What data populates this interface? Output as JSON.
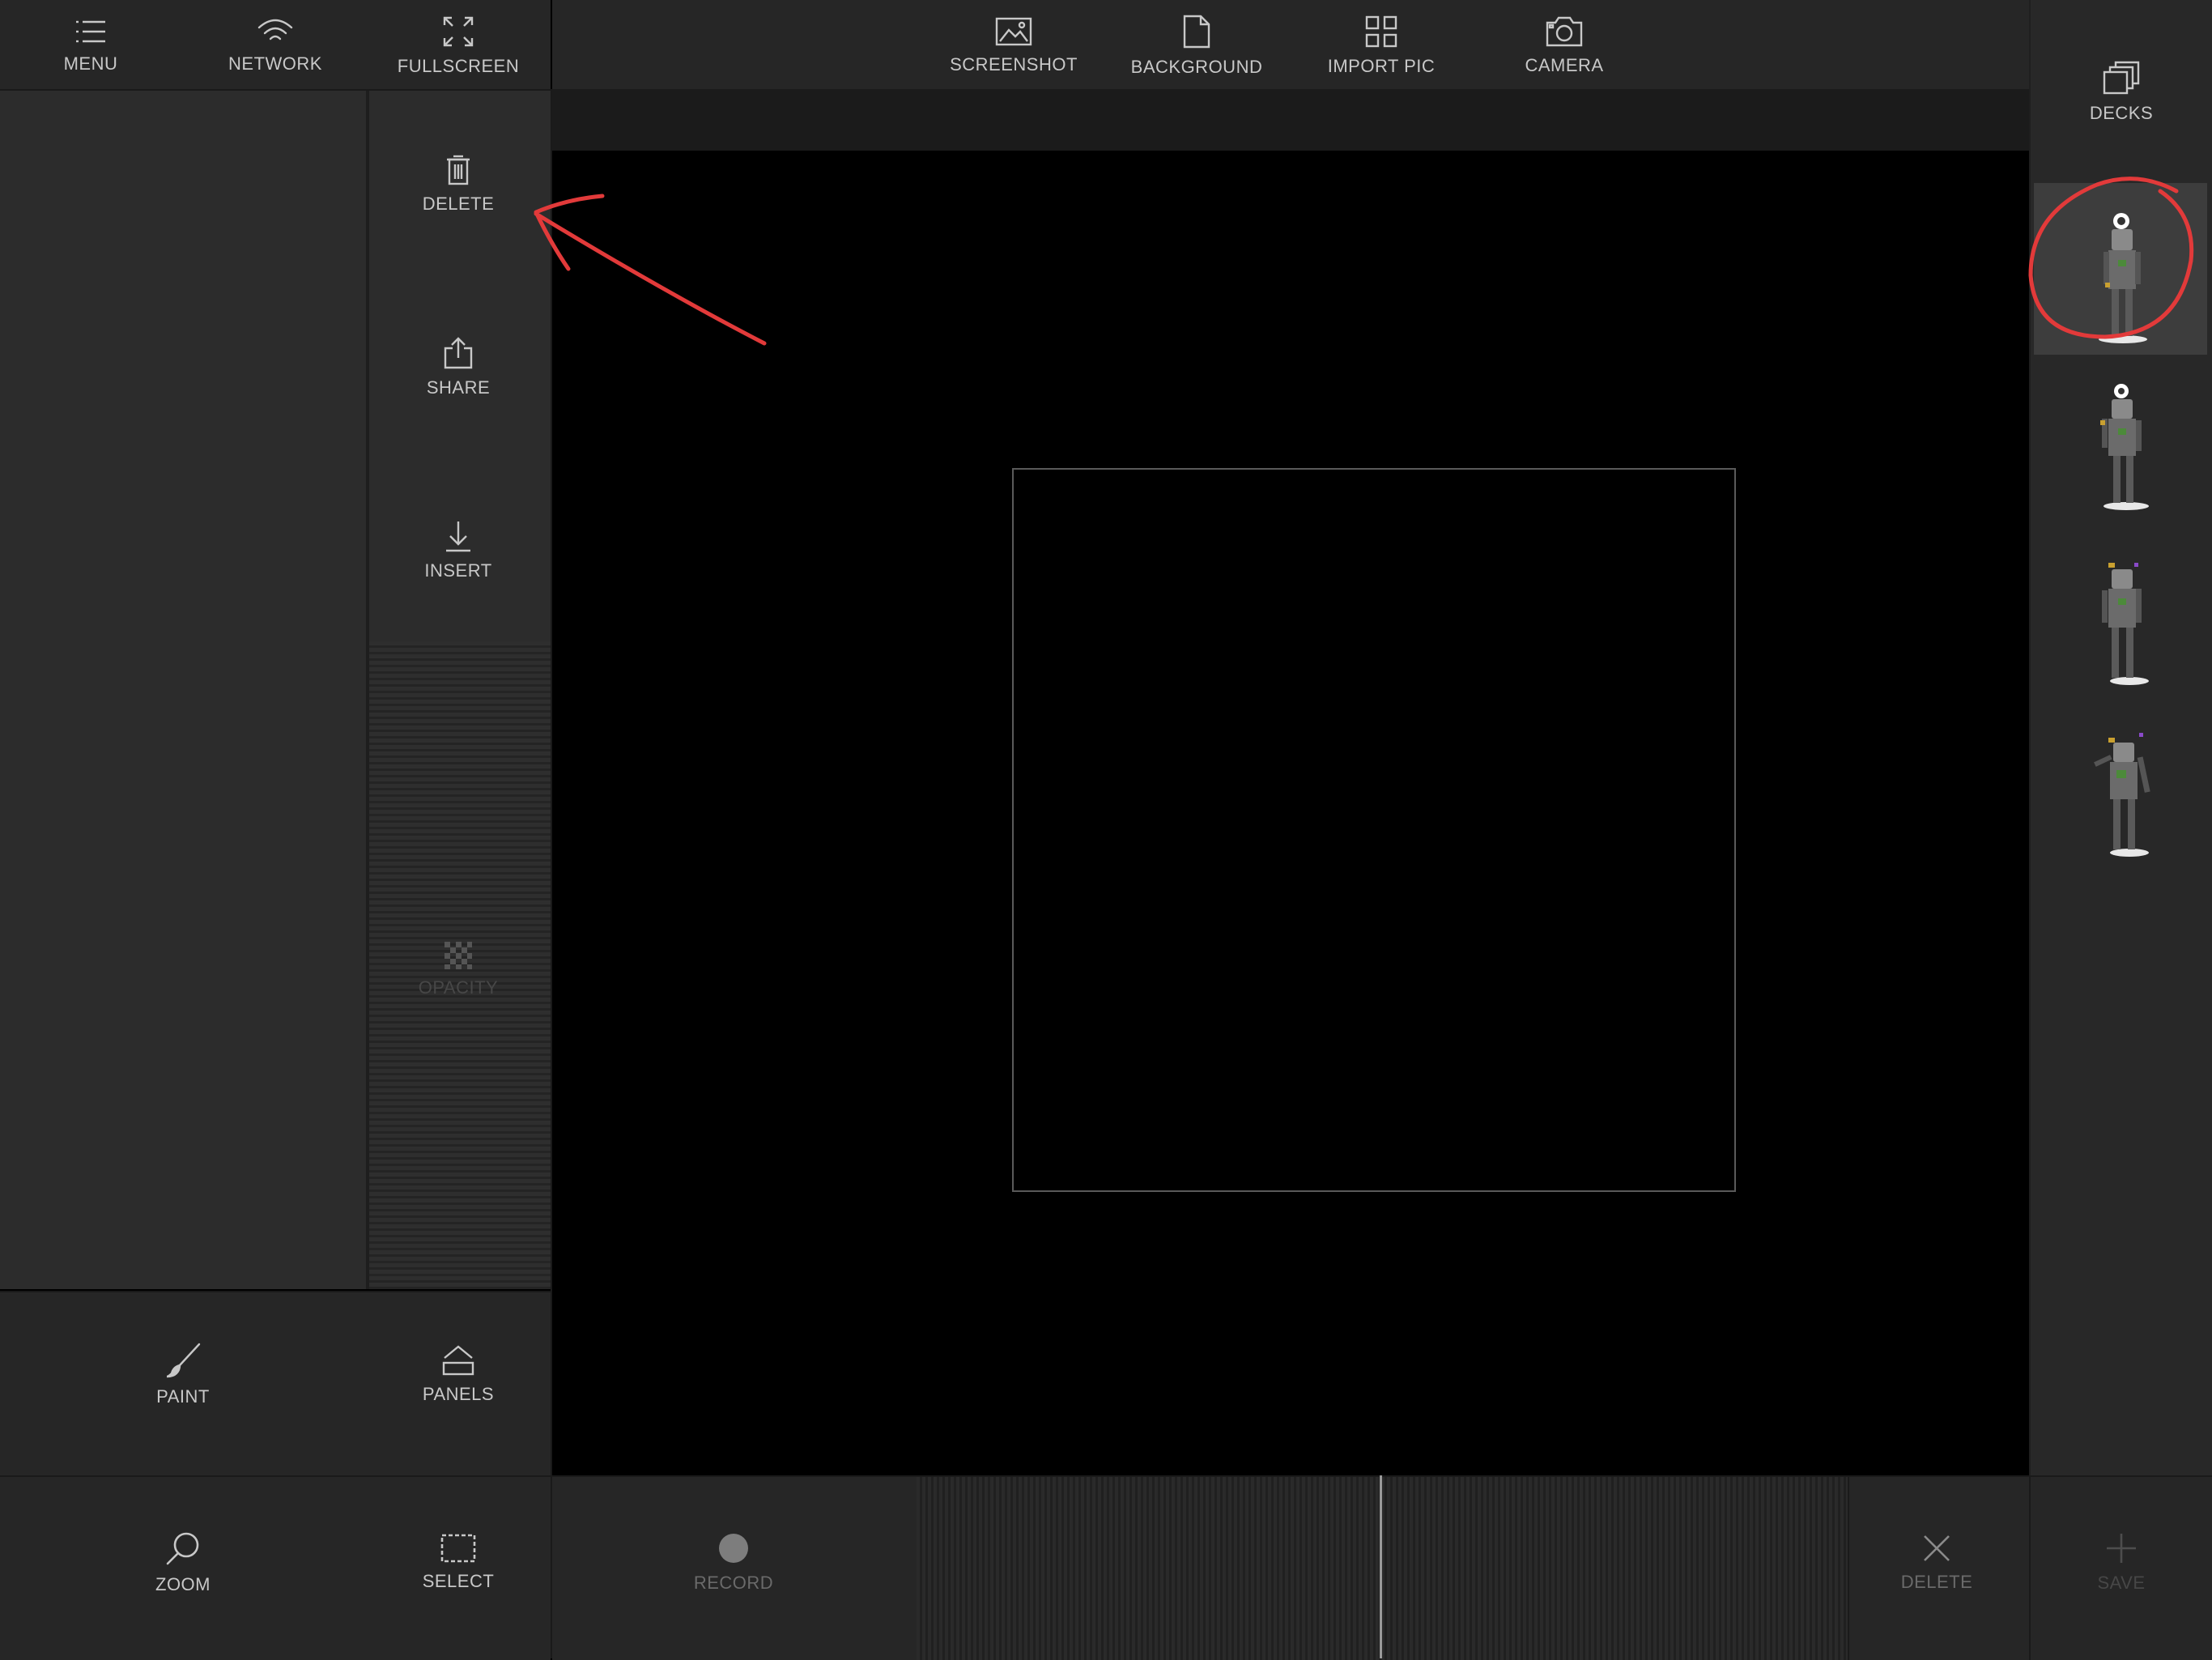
{
  "top_left_toolbar": {
    "menu": {
      "label": "MENU",
      "icon": "list-icon"
    },
    "network": {
      "label": "NETWORK",
      "icon": "wifi-icon"
    },
    "fullscreen": {
      "label": "FULLSCREEN",
      "icon": "expand-icon"
    }
  },
  "top_toolbar": {
    "screenshot": {
      "label": "SCREENSHOT",
      "icon": "image-icon"
    },
    "background": {
      "label": "BACKGROUND",
      "icon": "document-icon"
    },
    "import_pic": {
      "label": "IMPORT PIC",
      "icon": "grid-icon"
    },
    "camera": {
      "label": "CAMERA",
      "icon": "camera-icon"
    }
  },
  "right_panel": {
    "decks": {
      "label": "DECKS",
      "icon": "stack-icon"
    },
    "thumbnails": [
      {
        "name": "robot-frame-1",
        "selected": true
      },
      {
        "name": "robot-frame-2",
        "selected": false
      },
      {
        "name": "robot-frame-3",
        "selected": false
      },
      {
        "name": "robot-frame-4",
        "selected": false
      }
    ]
  },
  "actions": {
    "delete": {
      "label": "DELETE",
      "icon": "trash-icon"
    },
    "share": {
      "label": "SHARE",
      "icon": "share-icon"
    },
    "insert": {
      "label": "INSERT",
      "icon": "download-icon"
    },
    "opacity": {
      "label": "OPACITY",
      "icon": "checker-icon"
    }
  },
  "paint_bar": {
    "paint": {
      "label": "PAINT",
      "icon": "brush-icon"
    },
    "panels": {
      "label": "PANELS",
      "icon": "eject-icon"
    }
  },
  "bottom_bar": {
    "zoom": {
      "label": "ZOOM",
      "icon": "magnifier-icon"
    },
    "select": {
      "label": "SELECT",
      "icon": "marquee-icon"
    },
    "record": {
      "label": "RECORD",
      "icon": "record-dot-icon"
    },
    "delete": {
      "label": "DELETE",
      "icon": "close-icon"
    },
    "save": {
      "label": "SAVE",
      "icon": "plus-icon"
    }
  },
  "annotations": {
    "color": "#e23a3a",
    "arrow_target": "actions-delete",
    "circled_item": "robot-frame-1"
  },
  "colors": {
    "panel": "#2c2c2c",
    "toolbar": "#262626",
    "canvas": "#000000",
    "label": "#c8c8c8"
  }
}
